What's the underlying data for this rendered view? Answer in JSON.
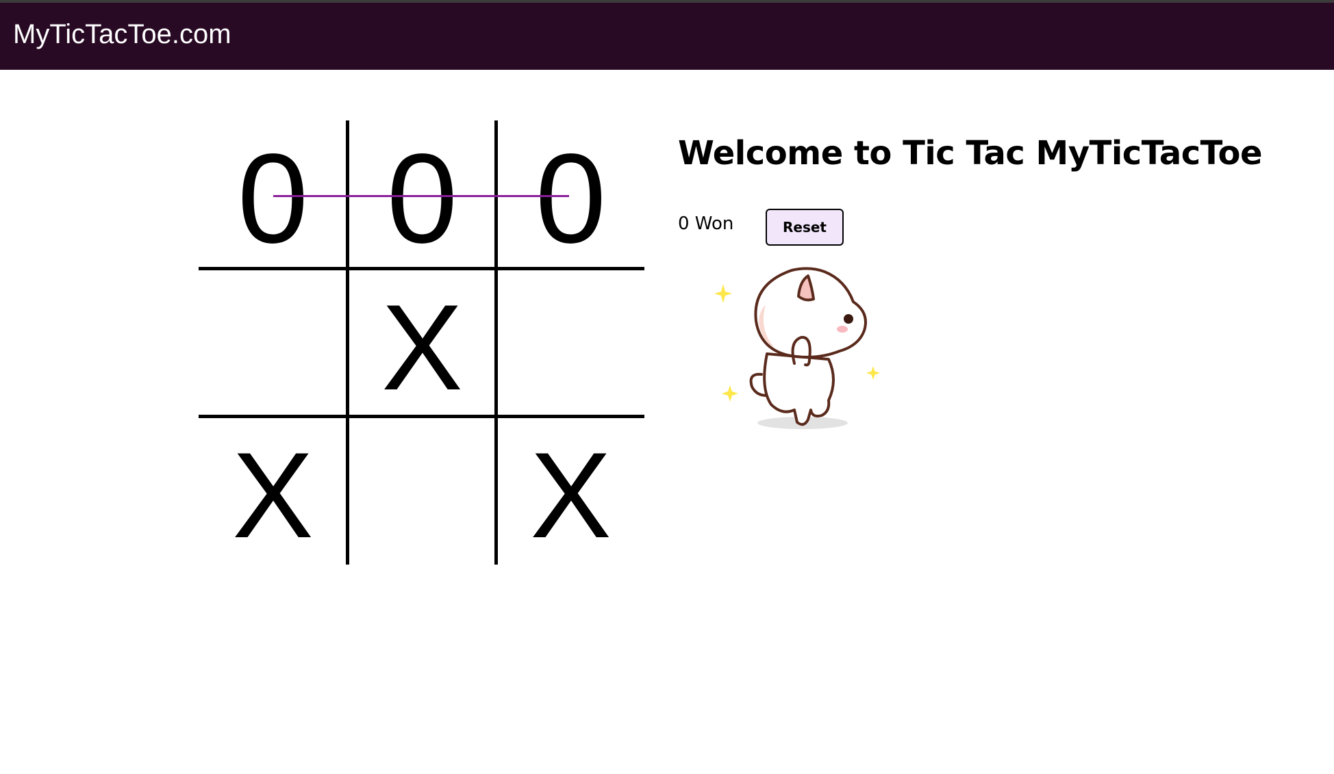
{
  "navbar": {
    "brand": "MyTicTacToe.com"
  },
  "board": {
    "cells": [
      {
        "row": 1,
        "col": 1,
        "mark": "0"
      },
      {
        "row": 1,
        "col": 2,
        "mark": "0"
      },
      {
        "row": 1,
        "col": 3,
        "mark": "0"
      },
      {
        "row": 2,
        "col": 1,
        "mark": ""
      },
      {
        "row": 2,
        "col": 2,
        "mark": "X"
      },
      {
        "row": 2,
        "col": 3,
        "mark": ""
      },
      {
        "row": 3,
        "col": 1,
        "mark": "X"
      },
      {
        "row": 3,
        "col": 2,
        "mark": ""
      },
      {
        "row": 3,
        "col": 3,
        "mark": "X"
      }
    ],
    "winning_line": {
      "row": 1,
      "color": "#8b1d9a"
    }
  },
  "panel": {
    "title": "Welcome to Tic Tac MyTicTacToe",
    "status": "0 Won",
    "reset_label": "Reset"
  },
  "colors": {
    "navbar_bg": "#290a25",
    "reset_bg": "#f1e6fa",
    "sparkle": "#fde74a",
    "cat_outline": "#5a2a1c"
  },
  "illustration": "walking-cat-sticker"
}
